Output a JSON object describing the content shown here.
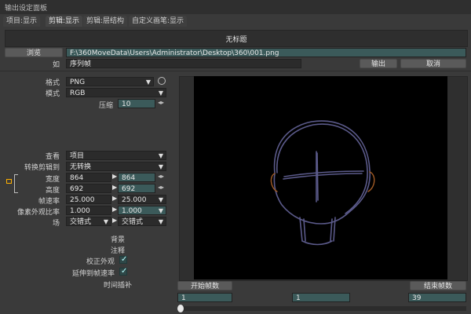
{
  "window": {
    "title": "输出设定面板"
  },
  "tabs": [
    {
      "label": "项目:显示",
      "active": false
    },
    {
      "label": "剪辑:显示",
      "active": true
    },
    {
      "label": "剪辑:层结构",
      "active": false
    },
    {
      "label": "自定义画笔:显示",
      "active": false
    }
  ],
  "header": {
    "title": "无标题"
  },
  "path": {
    "browse_label": "浏览",
    "value": "F:\\360MoveData\\Users\\Administrator\\Desktop\\360\\001.png"
  },
  "as": {
    "label": "如",
    "value": "序列帧",
    "output_label": "输出",
    "cancel_label": "取消"
  },
  "format": {
    "label": "格式",
    "value": "PNG"
  },
  "mode": {
    "label": "模式",
    "value": "RGB"
  },
  "compress": {
    "label": "压缩",
    "value": "10"
  },
  "view": {
    "label": "查看",
    "value": "项目"
  },
  "convert": {
    "label": "转换剪辑到",
    "value": "无转换"
  },
  "dims": {
    "width_label": "宽度",
    "width_a": "864",
    "width_b": "864",
    "height_label": "高度",
    "height_a": "692",
    "height_b": "692",
    "fps_label": "帧速率",
    "fps_a": "25.000",
    "fps_b": "25.000",
    "par_label": "像素外观比率",
    "par_a": "1.000",
    "par_b": "1.000",
    "field_label": "场",
    "field_a": "交错式",
    "field_b": "交错式"
  },
  "options": {
    "bg_label": "背景",
    "note_label": "注释",
    "correct_label": "校正外观",
    "extend_label": "延伸到帧速率",
    "interp_label": "时间插补"
  },
  "timeline": {
    "start_label": "开始帧数",
    "end_label": "结束帧数",
    "start_value": "1",
    "mid_value": "1",
    "end_value": "39"
  }
}
